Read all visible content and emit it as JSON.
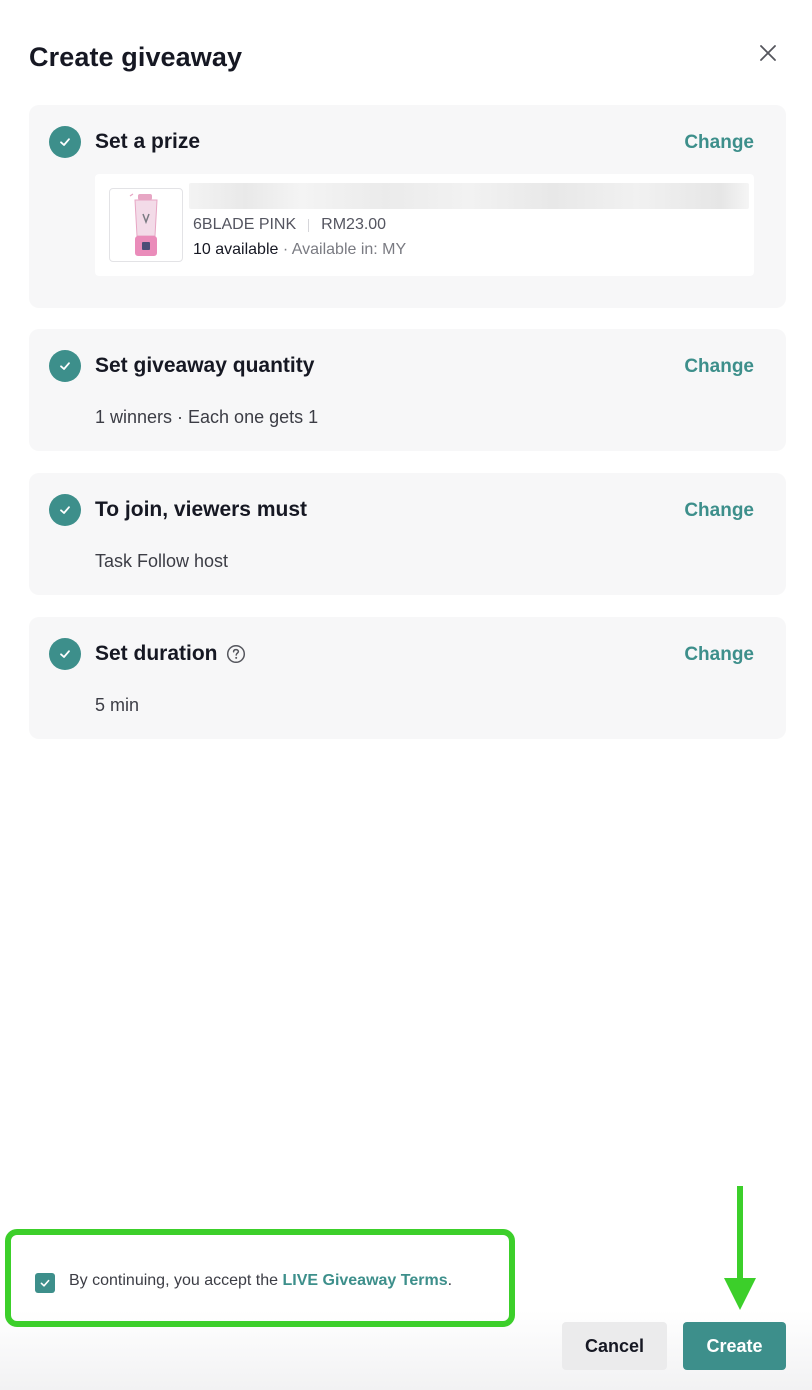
{
  "dialog": {
    "title": "Create giveaway",
    "close_icon": "close-icon"
  },
  "steps": [
    {
      "title": "Set a prize",
      "change_label": "Change",
      "status": "completed",
      "product": {
        "name_redacted": true,
        "variant": "6BLADE PINK",
        "price": "RM23.00",
        "available": "10 available",
        "available_in": "· Available in: MY",
        "thumbnail": "pink portable blender"
      }
    },
    {
      "title": "Set giveaway quantity",
      "change_label": "Change",
      "status": "completed",
      "detail": "1 winners · Each one gets 1"
    },
    {
      "title": "To join, viewers must",
      "change_label": "Change",
      "status": "completed",
      "detail": "Task Follow host"
    },
    {
      "title": "Set duration",
      "change_label": "Change",
      "status": "completed",
      "help_icon": "question-circle-icon",
      "detail": "5 min"
    }
  ],
  "terms": {
    "checked": true,
    "prefix": "By continuing, you accept the",
    "link": "LIVE Giveaway Terms",
    "suffix": "."
  },
  "buttons": {
    "cancel": "Cancel",
    "create": "Create"
  },
  "colors": {
    "accent": "#3d8f8b",
    "highlight": "#3ccf2a",
    "card_bg": "#f7f7f8"
  }
}
